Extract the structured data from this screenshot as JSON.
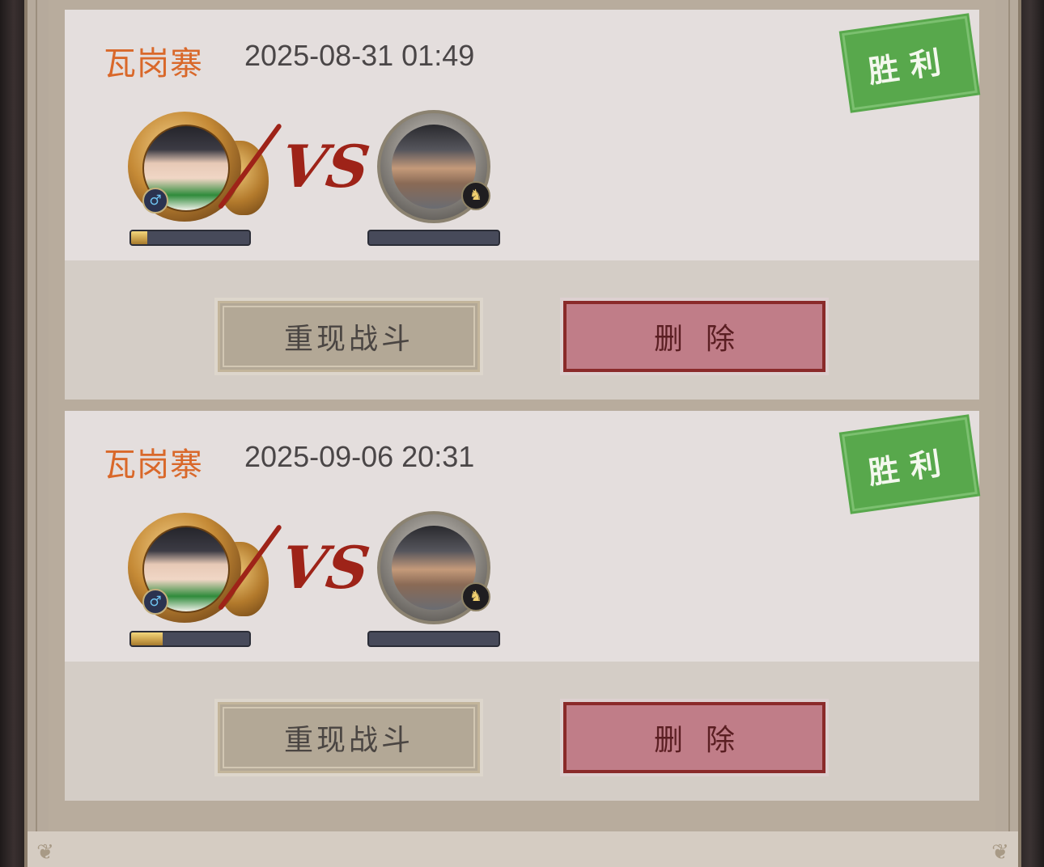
{
  "records": [
    {
      "location": "瓦岗寨",
      "time": "2025-08-31 01:49",
      "result": "胜利",
      "player_gender_icon": "♂",
      "opponent_badge_icon": "horse",
      "vs_label": "VS",
      "player_bar_fraction": 0.14,
      "opponent_bar_fraction": 0,
      "replay_label": "重现战斗",
      "delete_label": "删除"
    },
    {
      "location": "瓦岗寨",
      "time": "2025-09-06 20:31",
      "result": "胜利",
      "player_gender_icon": "♂",
      "opponent_badge_icon": "horse",
      "vs_label": "VS",
      "player_bar_fraction": 0.27,
      "opponent_bar_fraction": 0,
      "replay_label": "重现战斗",
      "delete_label": "删除"
    }
  ],
  "colors": {
    "location": "#d9682a",
    "win_stamp": "#58a84c",
    "delete_button": "#c07d88",
    "replay_button": "#b3a896"
  }
}
